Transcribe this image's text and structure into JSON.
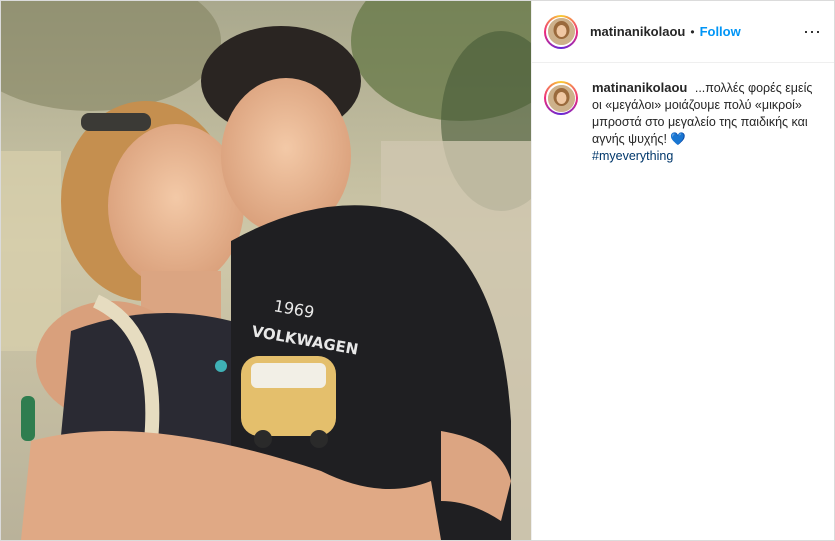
{
  "post": {
    "username": "matinanikolaou",
    "separator": "•",
    "follow_label": "Follow",
    "more_icon": "⋯",
    "caption": {
      "author": "matinanikolaou",
      "text": "...πολλές φορές εμείς οι «μεγάλοι» μοιάζουμε πολύ «μικροί» μπροστά στο μεγαλείο της παιδικής και αγνής ψυχής!",
      "emoji": "💙",
      "hashtag": "#myeverything"
    },
    "photo": {
      "shirt_text": [
        "1969",
        "VOLKWAGEN"
      ]
    }
  },
  "colors": {
    "follow_blue": "#0095f6",
    "hashtag_blue": "#00376b",
    "text": "#262626"
  }
}
